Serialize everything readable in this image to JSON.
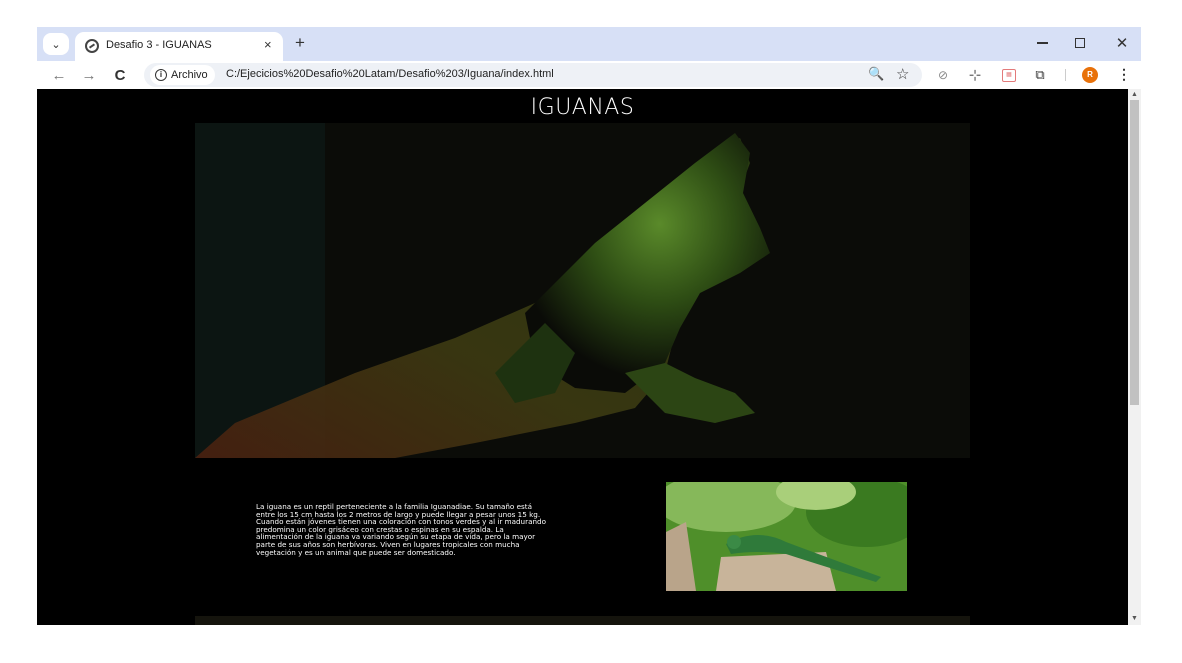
{
  "tabs": [
    {
      "title": "Desafio 3 - IGUANAS",
      "active": true
    }
  ],
  "tabstrip": {
    "new_tab": "+",
    "close_tab": "×",
    "search_tabs": "⌄"
  },
  "window_controls": {
    "close": "✕"
  },
  "toolbar": {
    "back": "←",
    "forward": "→",
    "reload": "C",
    "site_info_label": "Archivo",
    "url": "C:/Ejecicios%20Desafio%20Latam/Desafio%203/Iguana/index.html",
    "zoom": "🔍",
    "bookmark": "☆",
    "profile_initial": "R",
    "menu": "⋮"
  },
  "page": {
    "title": "IGUANAS",
    "description": "La iguana es un reptil perteneciente a la familia Iguanadiae. Su tamaño está entre los 15 cm hasta los 2 metros de largo y puede llegar a pesar unos 15 kg. Cuando están jóvenes tienen una coloración con tonos verdes y al ir madurando predomina un color grisáceo con crestas o espinas en su espalda. La alimentación de la iguana va variando según su etapa de vida, pero la mayor parte de sus años son herbívoras. Viven en lugares tropicales con mucha vegetación y es un animal que puede ser domesticado.",
    "hero_image": "hero-iguana-photo",
    "thumb_image": "iguana-on-stump-photo"
  },
  "colors": {
    "page_bg": "#000000",
    "text": "#ffffff",
    "tabstrip_bg": "#d7e0f6",
    "profile": "#e8710a"
  }
}
